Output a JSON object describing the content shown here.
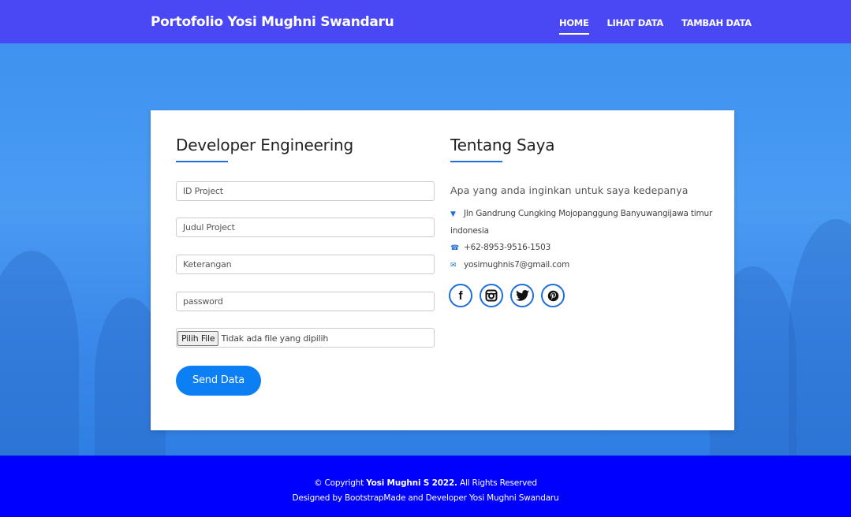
{
  "header": {
    "brand": "Portofolio Yosi Mughni Swandaru",
    "nav": [
      {
        "label": "HOME",
        "active": true
      },
      {
        "label": "LIHAT DATA",
        "active": false
      },
      {
        "label": "TAMBAH DATA",
        "active": false
      }
    ]
  },
  "form": {
    "title": "Developer Engineering",
    "fields": {
      "id_project": "ID Project",
      "judul_project": "Judul Project",
      "keterangan": "Keterangan",
      "password": "password"
    },
    "file_button": "Pilih File",
    "file_status": "Tidak ada file yang dipilih",
    "submit": "Send Data"
  },
  "about": {
    "title": "Tentang Saya",
    "lead": "Apa yang anda inginkan untuk saya kedepanya",
    "address_line1": "Jln Gandrung Cungking Mojopanggung Banyuwangijawa timur",
    "address_line2": "indonesia",
    "phone": "+62-8953-9516-1503",
    "email": "yosimughnis7@gmail.com",
    "socials": [
      "facebook",
      "instagram",
      "twitter",
      "pinterest"
    ]
  },
  "footer": {
    "copyright_prefix": "© Copyright ",
    "copyright_owner": "Yosi Mughni S 2022.",
    "copyright_suffix": " All Rights Reserved",
    "designed_by": "Designed by BootstrapMade and Developer Yosi Mughni Swandaru"
  },
  "colors": {
    "header_bg": "#4a47f4",
    "footer_bg": "#0000fe",
    "accent": "#0d7ff5"
  }
}
